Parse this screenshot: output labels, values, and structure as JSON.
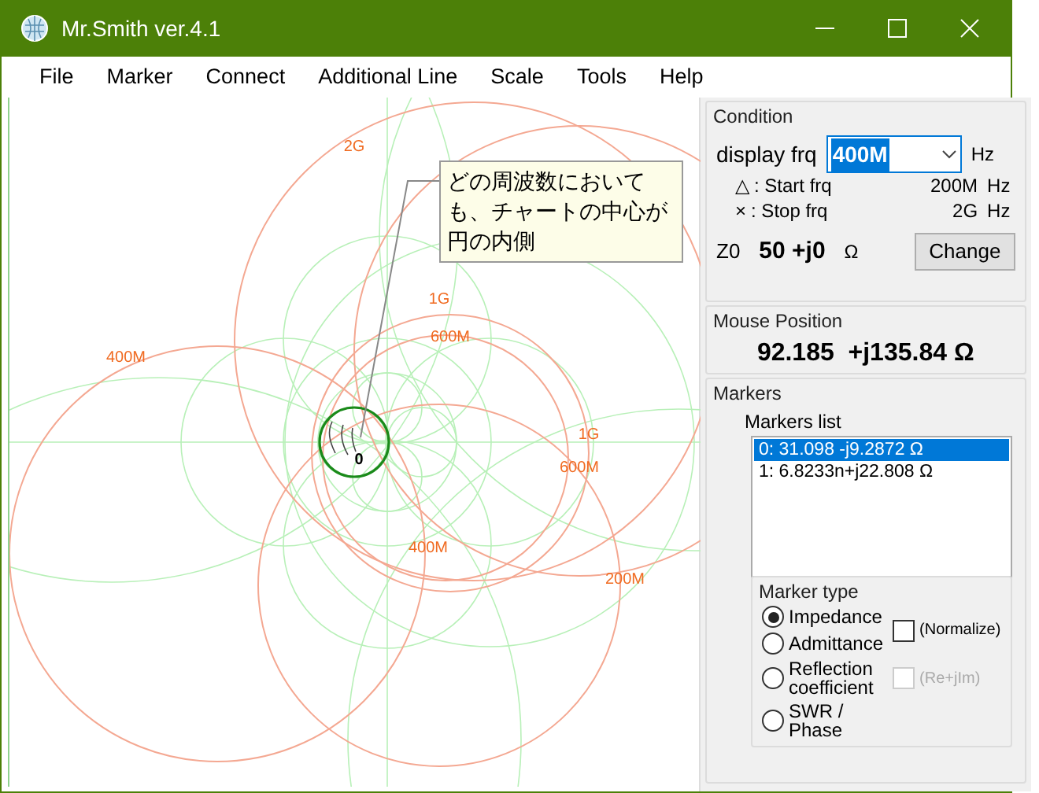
{
  "window": {
    "title": "Mr.Smith ver.4.1"
  },
  "menu": [
    "File",
    "Marker",
    "Connect",
    "Additional Line",
    "Scale",
    "Tools",
    "Help"
  ],
  "chart": {
    "frequency_labels": [
      "2G",
      "400M",
      "1G",
      "600M",
      "1G",
      "600M",
      "400M",
      "200M"
    ],
    "origin_label": "0",
    "callout": "どの周波数においても、チャートの中心が円の内側"
  },
  "condition": {
    "title": "Condition",
    "display_frq": {
      "label": "display frq",
      "value": "400M",
      "unit": "Hz"
    },
    "start": {
      "symbol": "△",
      "label": ": Start frq",
      "value": "200M",
      "unit": "Hz"
    },
    "stop": {
      "symbol": "×",
      "label": ": Stop frq",
      "value": "2G",
      "unit": "Hz"
    },
    "z0": {
      "label": "Z0",
      "value": "50 +j0",
      "unit": "Ω",
      "button": "Change"
    }
  },
  "mouse_position": {
    "title": "Mouse Position",
    "value": "92.185  +j135.84 Ω"
  },
  "markers": {
    "title": "Markers",
    "list_label": "Markers list",
    "items": [
      {
        "text": "0: 31.098 -j9.2872 Ω",
        "selected": true
      },
      {
        "text": "1: 6.8233n+j22.808 Ω",
        "selected": false
      }
    ],
    "marker_type": {
      "title": "Marker type",
      "options": [
        {
          "label": "Impedance",
          "selected": true
        },
        {
          "label": "Admittance",
          "selected": false
        },
        {
          "label": "Reflection coefficient",
          "selected": false
        },
        {
          "label": "SWR / Phase",
          "selected": false
        }
      ],
      "checkboxes": [
        {
          "label": "(Normalize)",
          "checked": false,
          "disabled": false
        },
        {
          "label": "(Re+jIm)",
          "checked": false,
          "disabled": true
        }
      ]
    }
  }
}
